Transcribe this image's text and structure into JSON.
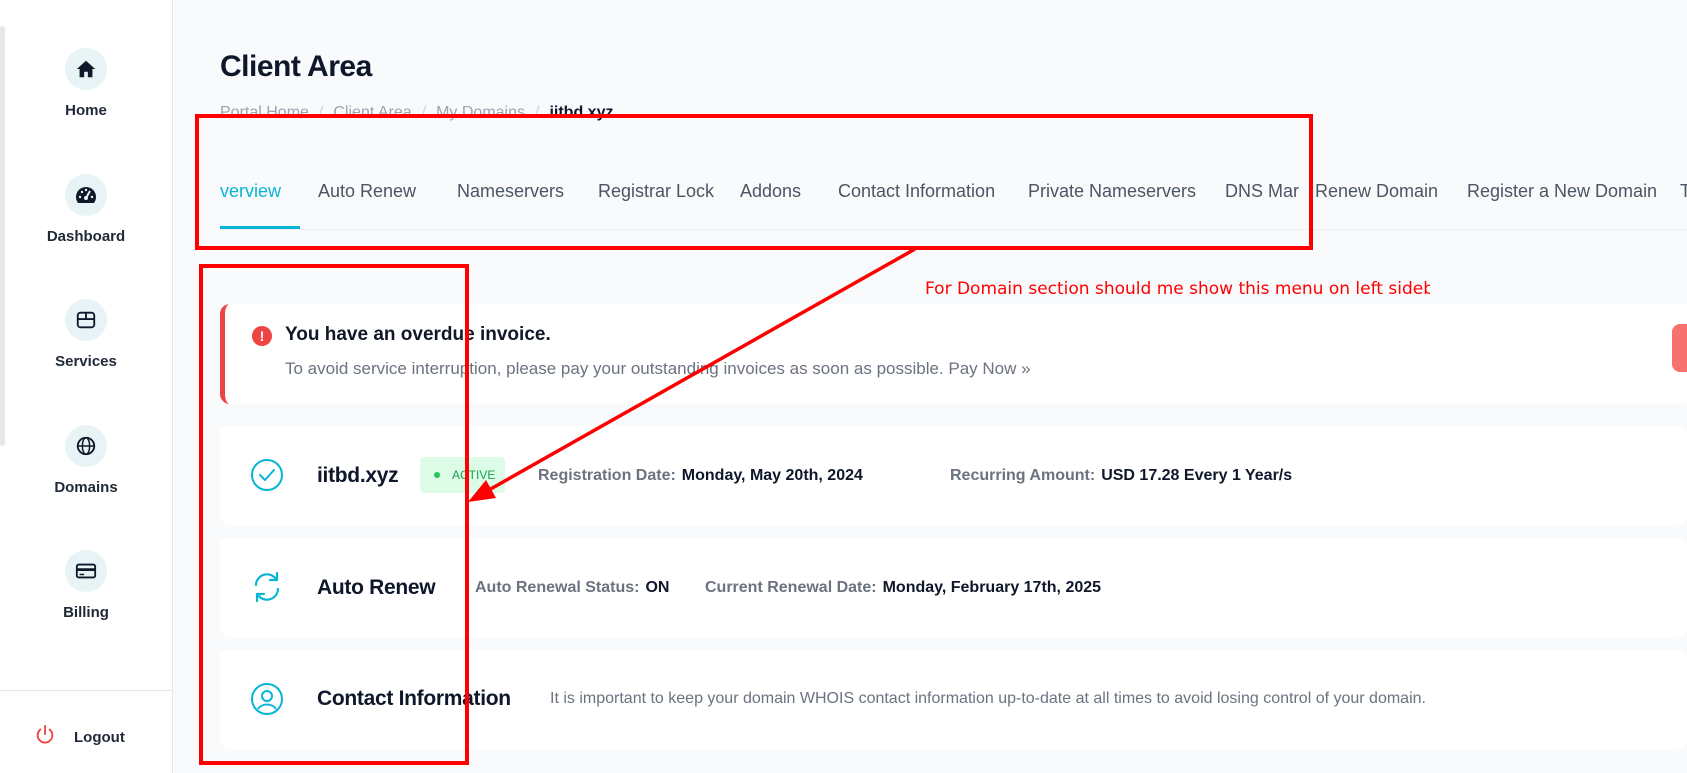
{
  "sidebar": {
    "items": [
      {
        "label": "Home",
        "icon": "home-icon"
      },
      {
        "label": "Dashboard",
        "icon": "dashboard-gauge-icon"
      },
      {
        "label": "Services",
        "icon": "box-icon"
      },
      {
        "label": "Domains",
        "icon": "globe-icon"
      },
      {
        "label": "Billing",
        "icon": "credit-card-icon"
      }
    ],
    "logout_label": "Logout"
  },
  "page": {
    "title": "Client Area",
    "breadcrumb": [
      "Portal Home",
      "Client Area",
      "My Domains",
      "iitbd.xyz"
    ]
  },
  "tabs": [
    {
      "label": "verview",
      "active": true
    },
    {
      "label": "Auto Renew"
    },
    {
      "label": "Nameservers"
    },
    {
      "label": "Registrar Lock"
    },
    {
      "label": "Addons"
    },
    {
      "label": "Contact Information"
    },
    {
      "label": "Private Nameservers"
    },
    {
      "label": "DNS Mar"
    },
    {
      "label": "Renew Domain"
    },
    {
      "label": "Register a New Domain"
    },
    {
      "label": "T"
    }
  ],
  "alert": {
    "title": "You have an overdue invoice.",
    "text": "To avoid service interruption, please pay your outstanding invoices as soon as possible. Pay Now »"
  },
  "domain_card": {
    "domain": "iitbd.xyz",
    "status": "ACTIVE",
    "registration_label": "Registration Date:",
    "registration_value": "Monday, May 20th, 2024",
    "recurring_label": "Recurring Amount:",
    "recurring_value": "USD 17.28 Every 1 Year/s"
  },
  "autorenew_card": {
    "title": "Auto Renew",
    "status_label": "Auto Renewal Status:",
    "status_value": "ON",
    "date_label": "Current Renewal Date:",
    "date_value": "Monday, February 17th, 2025"
  },
  "contact_card": {
    "title": "Contact Information",
    "description": "It is important to keep your domain WHOIS contact information up-to-date at all times to avoid losing control of your domain."
  },
  "annotation": {
    "text": "For Domain section should me show this menu on left sideba",
    "color": "#ff0000"
  },
  "colors": {
    "accent": "#06b6d4",
    "danger": "#ef4444",
    "success": "#16a34a"
  }
}
